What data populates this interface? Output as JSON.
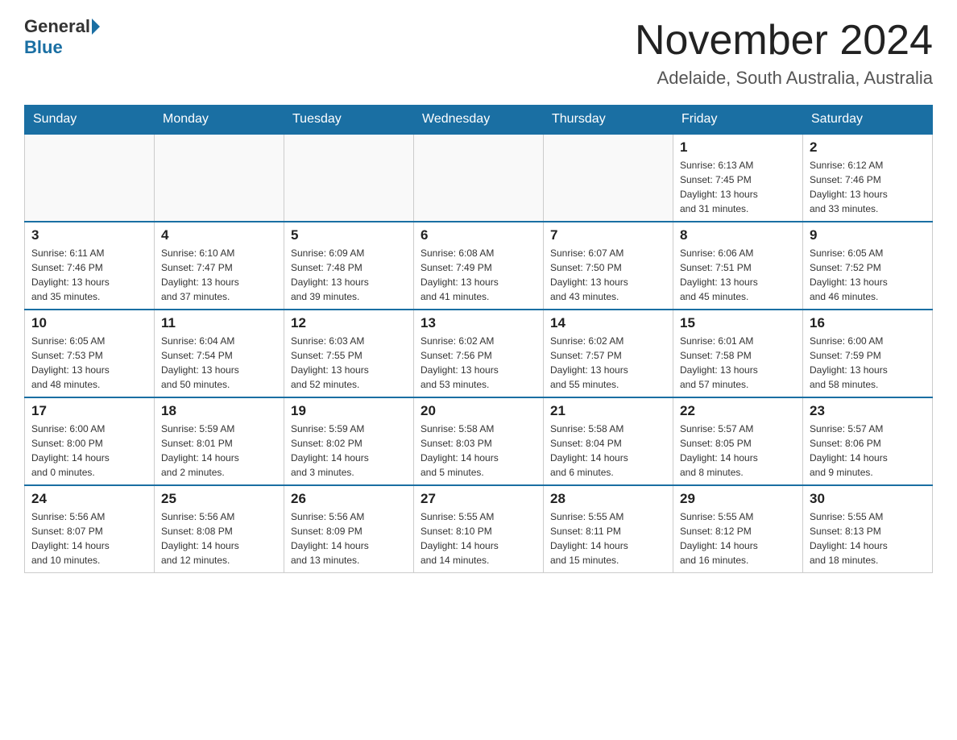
{
  "header": {
    "logo_general": "General",
    "logo_blue": "Blue",
    "title": "November 2024",
    "subtitle": "Adelaide, South Australia, Australia"
  },
  "days_of_week": [
    "Sunday",
    "Monday",
    "Tuesday",
    "Wednesday",
    "Thursday",
    "Friday",
    "Saturday"
  ],
  "weeks": [
    [
      {
        "day": "",
        "info": ""
      },
      {
        "day": "",
        "info": ""
      },
      {
        "day": "",
        "info": ""
      },
      {
        "day": "",
        "info": ""
      },
      {
        "day": "",
        "info": ""
      },
      {
        "day": "1",
        "info": "Sunrise: 6:13 AM\nSunset: 7:45 PM\nDaylight: 13 hours\nand 31 minutes."
      },
      {
        "day": "2",
        "info": "Sunrise: 6:12 AM\nSunset: 7:46 PM\nDaylight: 13 hours\nand 33 minutes."
      }
    ],
    [
      {
        "day": "3",
        "info": "Sunrise: 6:11 AM\nSunset: 7:46 PM\nDaylight: 13 hours\nand 35 minutes."
      },
      {
        "day": "4",
        "info": "Sunrise: 6:10 AM\nSunset: 7:47 PM\nDaylight: 13 hours\nand 37 minutes."
      },
      {
        "day": "5",
        "info": "Sunrise: 6:09 AM\nSunset: 7:48 PM\nDaylight: 13 hours\nand 39 minutes."
      },
      {
        "day": "6",
        "info": "Sunrise: 6:08 AM\nSunset: 7:49 PM\nDaylight: 13 hours\nand 41 minutes."
      },
      {
        "day": "7",
        "info": "Sunrise: 6:07 AM\nSunset: 7:50 PM\nDaylight: 13 hours\nand 43 minutes."
      },
      {
        "day": "8",
        "info": "Sunrise: 6:06 AM\nSunset: 7:51 PM\nDaylight: 13 hours\nand 45 minutes."
      },
      {
        "day": "9",
        "info": "Sunrise: 6:05 AM\nSunset: 7:52 PM\nDaylight: 13 hours\nand 46 minutes."
      }
    ],
    [
      {
        "day": "10",
        "info": "Sunrise: 6:05 AM\nSunset: 7:53 PM\nDaylight: 13 hours\nand 48 minutes."
      },
      {
        "day": "11",
        "info": "Sunrise: 6:04 AM\nSunset: 7:54 PM\nDaylight: 13 hours\nand 50 minutes."
      },
      {
        "day": "12",
        "info": "Sunrise: 6:03 AM\nSunset: 7:55 PM\nDaylight: 13 hours\nand 52 minutes."
      },
      {
        "day": "13",
        "info": "Sunrise: 6:02 AM\nSunset: 7:56 PM\nDaylight: 13 hours\nand 53 minutes."
      },
      {
        "day": "14",
        "info": "Sunrise: 6:02 AM\nSunset: 7:57 PM\nDaylight: 13 hours\nand 55 minutes."
      },
      {
        "day": "15",
        "info": "Sunrise: 6:01 AM\nSunset: 7:58 PM\nDaylight: 13 hours\nand 57 minutes."
      },
      {
        "day": "16",
        "info": "Sunrise: 6:00 AM\nSunset: 7:59 PM\nDaylight: 13 hours\nand 58 minutes."
      }
    ],
    [
      {
        "day": "17",
        "info": "Sunrise: 6:00 AM\nSunset: 8:00 PM\nDaylight: 14 hours\nand 0 minutes."
      },
      {
        "day": "18",
        "info": "Sunrise: 5:59 AM\nSunset: 8:01 PM\nDaylight: 14 hours\nand 2 minutes."
      },
      {
        "day": "19",
        "info": "Sunrise: 5:59 AM\nSunset: 8:02 PM\nDaylight: 14 hours\nand 3 minutes."
      },
      {
        "day": "20",
        "info": "Sunrise: 5:58 AM\nSunset: 8:03 PM\nDaylight: 14 hours\nand 5 minutes."
      },
      {
        "day": "21",
        "info": "Sunrise: 5:58 AM\nSunset: 8:04 PM\nDaylight: 14 hours\nand 6 minutes."
      },
      {
        "day": "22",
        "info": "Sunrise: 5:57 AM\nSunset: 8:05 PM\nDaylight: 14 hours\nand 8 minutes."
      },
      {
        "day": "23",
        "info": "Sunrise: 5:57 AM\nSunset: 8:06 PM\nDaylight: 14 hours\nand 9 minutes."
      }
    ],
    [
      {
        "day": "24",
        "info": "Sunrise: 5:56 AM\nSunset: 8:07 PM\nDaylight: 14 hours\nand 10 minutes."
      },
      {
        "day": "25",
        "info": "Sunrise: 5:56 AM\nSunset: 8:08 PM\nDaylight: 14 hours\nand 12 minutes."
      },
      {
        "day": "26",
        "info": "Sunrise: 5:56 AM\nSunset: 8:09 PM\nDaylight: 14 hours\nand 13 minutes."
      },
      {
        "day": "27",
        "info": "Sunrise: 5:55 AM\nSunset: 8:10 PM\nDaylight: 14 hours\nand 14 minutes."
      },
      {
        "day": "28",
        "info": "Sunrise: 5:55 AM\nSunset: 8:11 PM\nDaylight: 14 hours\nand 15 minutes."
      },
      {
        "day": "29",
        "info": "Sunrise: 5:55 AM\nSunset: 8:12 PM\nDaylight: 14 hours\nand 16 minutes."
      },
      {
        "day": "30",
        "info": "Sunrise: 5:55 AM\nSunset: 8:13 PM\nDaylight: 14 hours\nand 18 minutes."
      }
    ]
  ]
}
